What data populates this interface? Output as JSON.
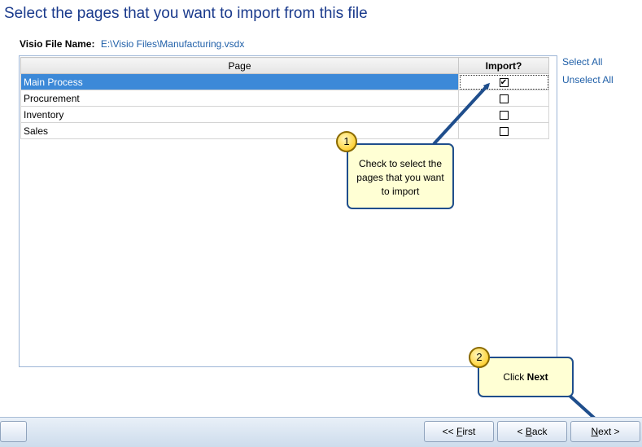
{
  "header": {
    "title": "Select the pages that you want to import from this file"
  },
  "file": {
    "label": "Visio File Name:",
    "value": "E:\\Visio Files\\Manufacturing.vsdx"
  },
  "grid": {
    "columns": [
      "Page",
      "Import?"
    ],
    "rows": [
      {
        "page": "Main Process",
        "import": true,
        "selected": true
      },
      {
        "page": "Procurement",
        "import": false,
        "selected": false
      },
      {
        "page": "Inventory",
        "import": false,
        "selected": false
      },
      {
        "page": "Sales",
        "import": false,
        "selected": false
      }
    ]
  },
  "links": {
    "select_all": "Select All",
    "unselect_all": "Unselect All"
  },
  "callouts": [
    {
      "number": "1",
      "text": "Check to select the pages that you want to import"
    },
    {
      "number": "2",
      "text_prefix": "Click ",
      "text_bold": "Next"
    }
  ],
  "buttons": {
    "first": {
      "prefix": "<< ",
      "accel": "F",
      "rest": "irst"
    },
    "back": {
      "prefix": "< ",
      "accel": "B",
      "rest": "ack"
    },
    "next": {
      "accel": "N",
      "rest": "ext >"
    }
  },
  "colors": {
    "accent": "#1f4e8c",
    "selection": "#3c89d8",
    "callout_bg": "#ffffd4",
    "badge": "#ffd33a"
  }
}
